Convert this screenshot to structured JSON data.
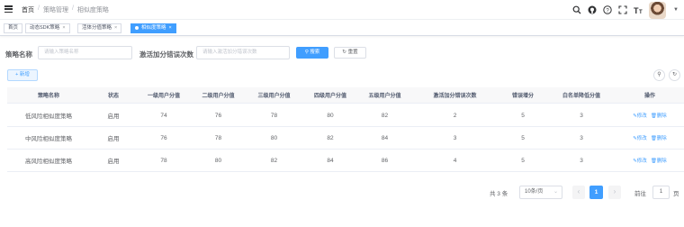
{
  "header": {
    "breadcrumb": [
      "首页",
      "策略管理",
      "相似度策略"
    ],
    "tool_icons": [
      "search-icon",
      "github-icon",
      "help-icon",
      "fullscreen-icon",
      "font-size-icon"
    ]
  },
  "tags": [
    {
      "label": "首页",
      "active": false
    },
    {
      "label": "动态SDK策略",
      "active": false
    },
    {
      "label": "活体分值策略",
      "active": false
    },
    {
      "label": "相似度策略",
      "active": true
    }
  ],
  "search": {
    "policy_name_label": "策略名称",
    "policy_name_placeholder": "请输入策略名称",
    "activation_label": "激活加分错误次数",
    "activation_placeholder": "请输入激活加分错误次数",
    "search_button": "搜索",
    "reset_button": "重置"
  },
  "toolbar": {
    "add_button": "新增"
  },
  "table": {
    "headers": [
      "策略名称",
      "状态",
      "一级用户分值",
      "二级用户分值",
      "三级用户分值",
      "四级用户分值",
      "五级用户分值",
      "激活加分错误次数",
      "错误增分",
      "白名单降低分值",
      "操作"
    ],
    "rows": [
      [
        "低风险相似度策略",
        "启用",
        "74",
        "76",
        "78",
        "80",
        "82",
        "2",
        "5",
        "3"
      ],
      [
        "中风险相似度策略",
        "启用",
        "76",
        "78",
        "80",
        "82",
        "84",
        "3",
        "5",
        "3"
      ],
      [
        "高风险相似度策略",
        "启用",
        "78",
        "80",
        "82",
        "84",
        "86",
        "4",
        "5",
        "3"
      ]
    ],
    "edit_label": "修改",
    "delete_label": "删除"
  },
  "pagination": {
    "total": "共 3 条",
    "page_size": "10条/页",
    "current_page": "1",
    "goto_prefix": "前往",
    "goto_value": "1",
    "goto_suffix": "页"
  },
  "colors": {
    "primary": "#409eff",
    "text": "#606266",
    "border": "#ebeef5"
  }
}
